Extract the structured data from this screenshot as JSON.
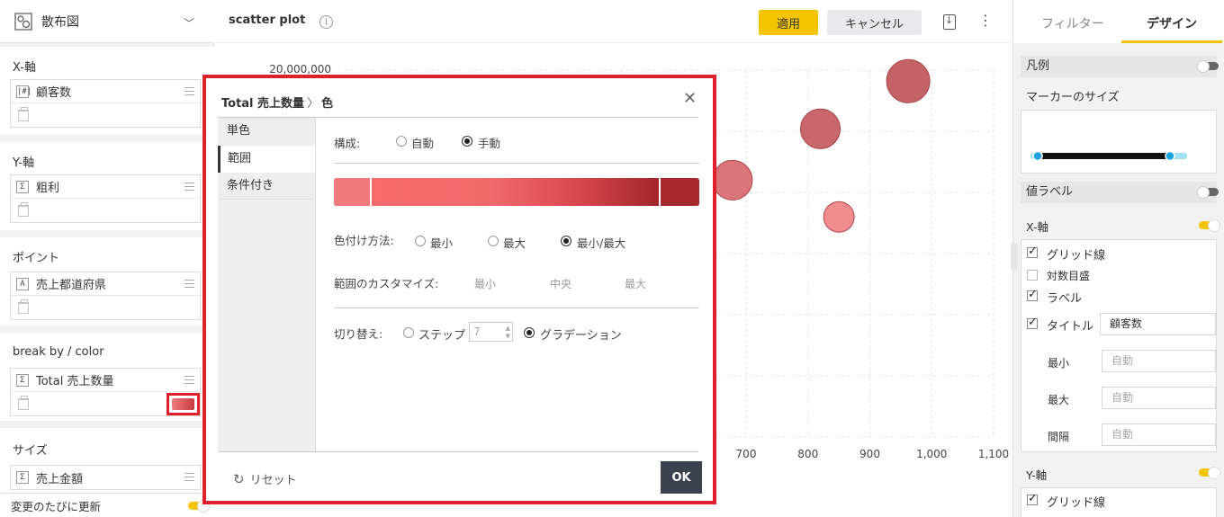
{
  "left_panel": {
    "chart_type": "散布図",
    "sections": {
      "x_axis": {
        "label": "X-軸",
        "field_type": "|#|",
        "field": "顧客数"
      },
      "y_axis": {
        "label": "Y-軸",
        "field_type": "Σ",
        "field": "粗利"
      },
      "point": {
        "label": "ポイント",
        "field_type": "A",
        "field": "売上都道府県"
      },
      "break_by": {
        "label": "break by / color",
        "field_type": "Σ",
        "field": "Total 売上数量"
      },
      "size": {
        "label": "サイズ",
        "field_type": "Σ",
        "field": "売上金額"
      }
    },
    "footer_label": "変更のたびに更新"
  },
  "toolbar": {
    "title": "scatter plot",
    "info_glyph": "i",
    "apply_label": "適用",
    "cancel_label": "キャンセル",
    "more_glyph": "⋮"
  },
  "chart_data": {
    "type": "scatter",
    "y_tick_top": "20,000,000",
    "x_ticks": [
      "700",
      "800",
      "900",
      "1,000",
      "1,100"
    ],
    "points": [
      {
        "x": 962,
        "y": 19400000,
        "size": "large",
        "color": "#c0555a"
      },
      {
        "x": 820,
        "y": 16800000,
        "size": "medium",
        "color": "#c55c60"
      },
      {
        "x": 678,
        "y": 14000000,
        "size": "medium",
        "color": "#d96a6e"
      },
      {
        "x": 850,
        "y": 12000000,
        "size": "small",
        "color": "#ef8285"
      }
    ],
    "grid": true,
    "colors": {
      "low": "#f07a7c",
      "high": "#a6282d"
    }
  },
  "modal": {
    "title_field": "Total 売上数量",
    "title_sep": "〉",
    "title_section": "色",
    "close_glyph": "✕",
    "side_items": [
      "単色",
      "範囲",
      "条件付き"
    ],
    "active_side": 1,
    "config_label": "構成:",
    "config_options": [
      "自動",
      "手動"
    ],
    "config_selected": "手動",
    "method_label": "色付け方法:",
    "method_options": [
      "最小",
      "最大",
      "最小/最大"
    ],
    "method_selected": "最小/最大",
    "customize_label": "範囲のカスタマイズ:",
    "customize_options": [
      "最小",
      "中央",
      "最大"
    ],
    "switch_label": "切り替え:",
    "switch_step": "ステップ",
    "step_value": "7",
    "switch_gradient": "グラデーション",
    "switch_selected": "グラデーション",
    "reset_label": "リセット",
    "ok_label": "OK"
  },
  "right_panel": {
    "tabs": [
      "フィルター",
      "デザイン"
    ],
    "active_tab": "デザイン",
    "legend_label": "凡例",
    "legend_on": false,
    "marker_size_label": "マーカーのサイズ",
    "marker_size_range": [
      0.0,
      0.8
    ],
    "value_label": "値ラベル",
    "value_label_on": false,
    "x_axis_label": "X-軸",
    "x_axis_on": true,
    "x_axis_options": {
      "grid": {
        "label": "グリッド線",
        "checked": true
      },
      "log": {
        "label": "対数目盛",
        "checked": false
      },
      "labels": {
        "label": "ラベル",
        "checked": true
      },
      "title": {
        "label": "タイトル",
        "checked": true,
        "value": "顧客数"
      },
      "min": {
        "label": "最小",
        "placeholder": "自動"
      },
      "max": {
        "label": "最大",
        "placeholder": "自動"
      },
      "interval": {
        "label": "間隔",
        "placeholder": "自動"
      }
    },
    "y_axis_label": "Y-軸",
    "y_axis_on": true,
    "y_grid_label": "グリッド線",
    "y_grid_checked": true
  }
}
